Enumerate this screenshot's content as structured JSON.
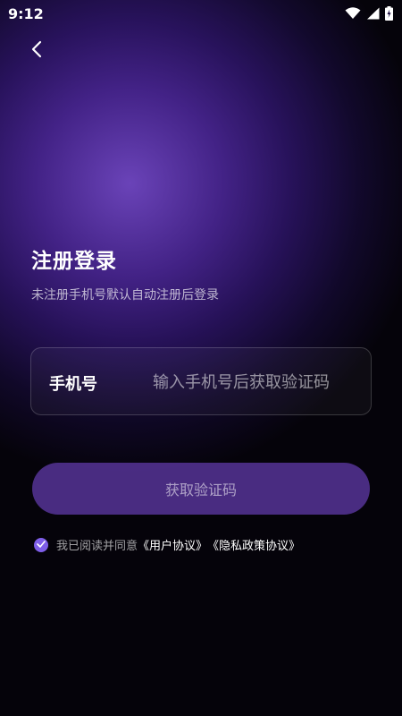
{
  "status_bar": {
    "time": "9:12",
    "icons": [
      "wifi-icon",
      "signal-icon",
      "battery-charging-icon"
    ]
  },
  "header": {
    "back_icon": "chevron-left-icon"
  },
  "main": {
    "title": "注册登录",
    "subtitle": "未注册手机号默认自动注册后登录",
    "phone_field": {
      "label": "手机号",
      "value": "",
      "placeholder": "输入手机号后获取验证码"
    },
    "get_code_button": {
      "label": "获取验证码"
    },
    "agreement": {
      "checked": true,
      "prefix": "我已阅读并同意",
      "user_agreement": "《用户协议》",
      "privacy_policy": "《隐私政策协议》"
    }
  },
  "colors": {
    "accent": "#7e5ee8",
    "button_bg": "#563496",
    "background_dark": "#05030a",
    "background_glow": "#6e46be"
  }
}
